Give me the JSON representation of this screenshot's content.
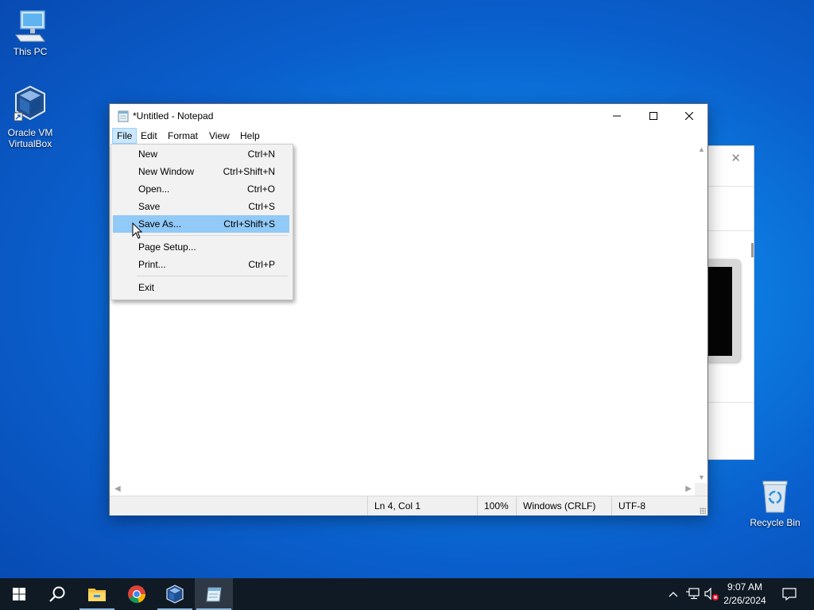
{
  "desktop": {
    "icons": [
      {
        "label": "This PC",
        "icon": "this-pc-icon"
      },
      {
        "label_line1": "Oracle VM",
        "label_line2": "VirtualBox",
        "icon": "virtualbox-icon"
      },
      {
        "label": "Recycle Bin",
        "icon": "recycle-bin-icon"
      }
    ]
  },
  "window": {
    "title": "*Untitled - Notepad",
    "menu": [
      "File",
      "Edit",
      "Format",
      "View",
      "Help"
    ],
    "active_menu": "File",
    "status": {
      "position": "Ln 4, Col 1",
      "zoom": "100%",
      "line_ending": "Windows (CRLF)",
      "encoding": "UTF-8"
    }
  },
  "file_menu": {
    "items": [
      {
        "label": "New",
        "shortcut": "Ctrl+N"
      },
      {
        "label": "New Window",
        "shortcut": "Ctrl+Shift+N"
      },
      {
        "label": "Open...",
        "shortcut": "Ctrl+O"
      },
      {
        "label": "Save",
        "shortcut": "Ctrl+S"
      },
      {
        "label": "Save As...",
        "shortcut": "Ctrl+Shift+S",
        "highlighted": true
      },
      {
        "label": "Page Setup...",
        "shortcut": ""
      },
      {
        "label": "Print...",
        "shortcut": "Ctrl+P"
      },
      {
        "label": "Exit",
        "shortcut": ""
      }
    ]
  },
  "taskbar": {
    "apps": [
      "start-icon",
      "search-icon",
      "file-explorer-icon",
      "chrome-icon",
      "virtualbox-icon",
      "notepad-icon"
    ],
    "clock": {
      "time": "9:07 AM",
      "date": "2/26/2024"
    }
  },
  "colors": {
    "menu_highlight": "#91c9f7",
    "active_menu_bg": "#cce8ff",
    "taskbar": "#101a24"
  }
}
